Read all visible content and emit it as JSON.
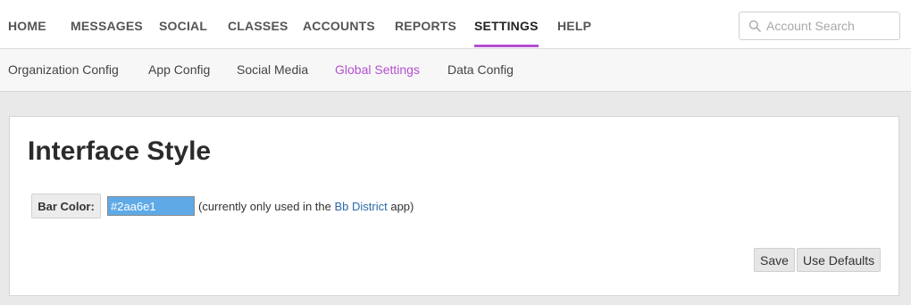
{
  "topnav": {
    "items": [
      "HOME",
      "MESSAGES",
      "SOCIAL",
      "CLASSES",
      "ACCOUNTS",
      "REPORTS",
      "SETTINGS",
      "HELP"
    ],
    "active": "SETTINGS",
    "accent_color": "#b44fd1"
  },
  "search": {
    "placeholder": "Account Search",
    "icon": "search-icon"
  },
  "subnav": {
    "items": [
      "Organization Config",
      "App Config",
      "Social Media",
      "Global Settings",
      "Data Config"
    ],
    "active": "Global Settings"
  },
  "main": {
    "title": "Interface Style",
    "bar_color_label": "Bar Color:",
    "bar_color_value": "#2aa6e1",
    "note_prefix": "(currently only used in the",
    "note_link": "Bb District",
    "note_suffix": "app)",
    "save_label": "Save",
    "defaults_label": "Use Defaults"
  }
}
